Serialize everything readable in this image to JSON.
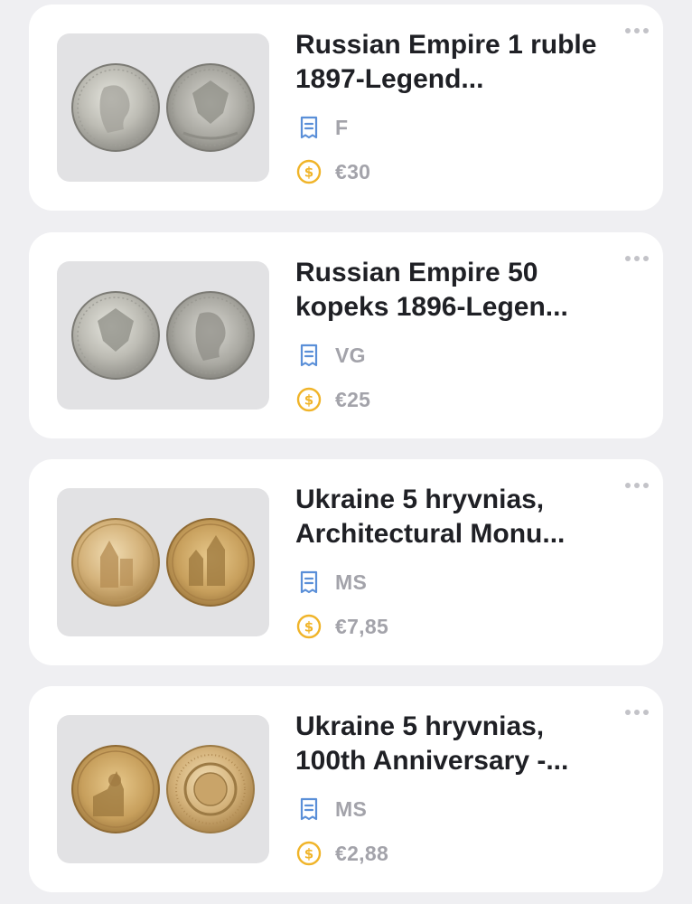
{
  "colors": {
    "background": "#efeff2",
    "card": "#ffffff",
    "title": "#1f2025",
    "meta_text": "#a3a3aa",
    "grade_icon": "#5a8fd8",
    "price_icon": "#f0b429",
    "more_dots": "#c3c3c8"
  },
  "icons": {
    "grade": "bookmark-receipt-icon",
    "price": "dollar-coin-icon",
    "menu": "more-horizontal-icon"
  },
  "coins": [
    {
      "title": "Russian Empire 1 ruble 1897-Legend...",
      "grade": "F",
      "price": "€30",
      "image": "silver-coin-pair"
    },
    {
      "title": "Russian Empire 50 kopeks 1896-Legen...",
      "grade": "VG",
      "price": "€25",
      "image": "silver-coin-pair"
    },
    {
      "title": "Ukraine 5 hryvnias, Architectural Monu...",
      "grade": "MS",
      "price": "€7,85",
      "image": "brass-coin-pair"
    },
    {
      "title": "Ukraine 5 hryvnias, 100th Anniversary -...",
      "grade": "MS",
      "price": "€2,88",
      "image": "brass-coin-pair"
    }
  ]
}
